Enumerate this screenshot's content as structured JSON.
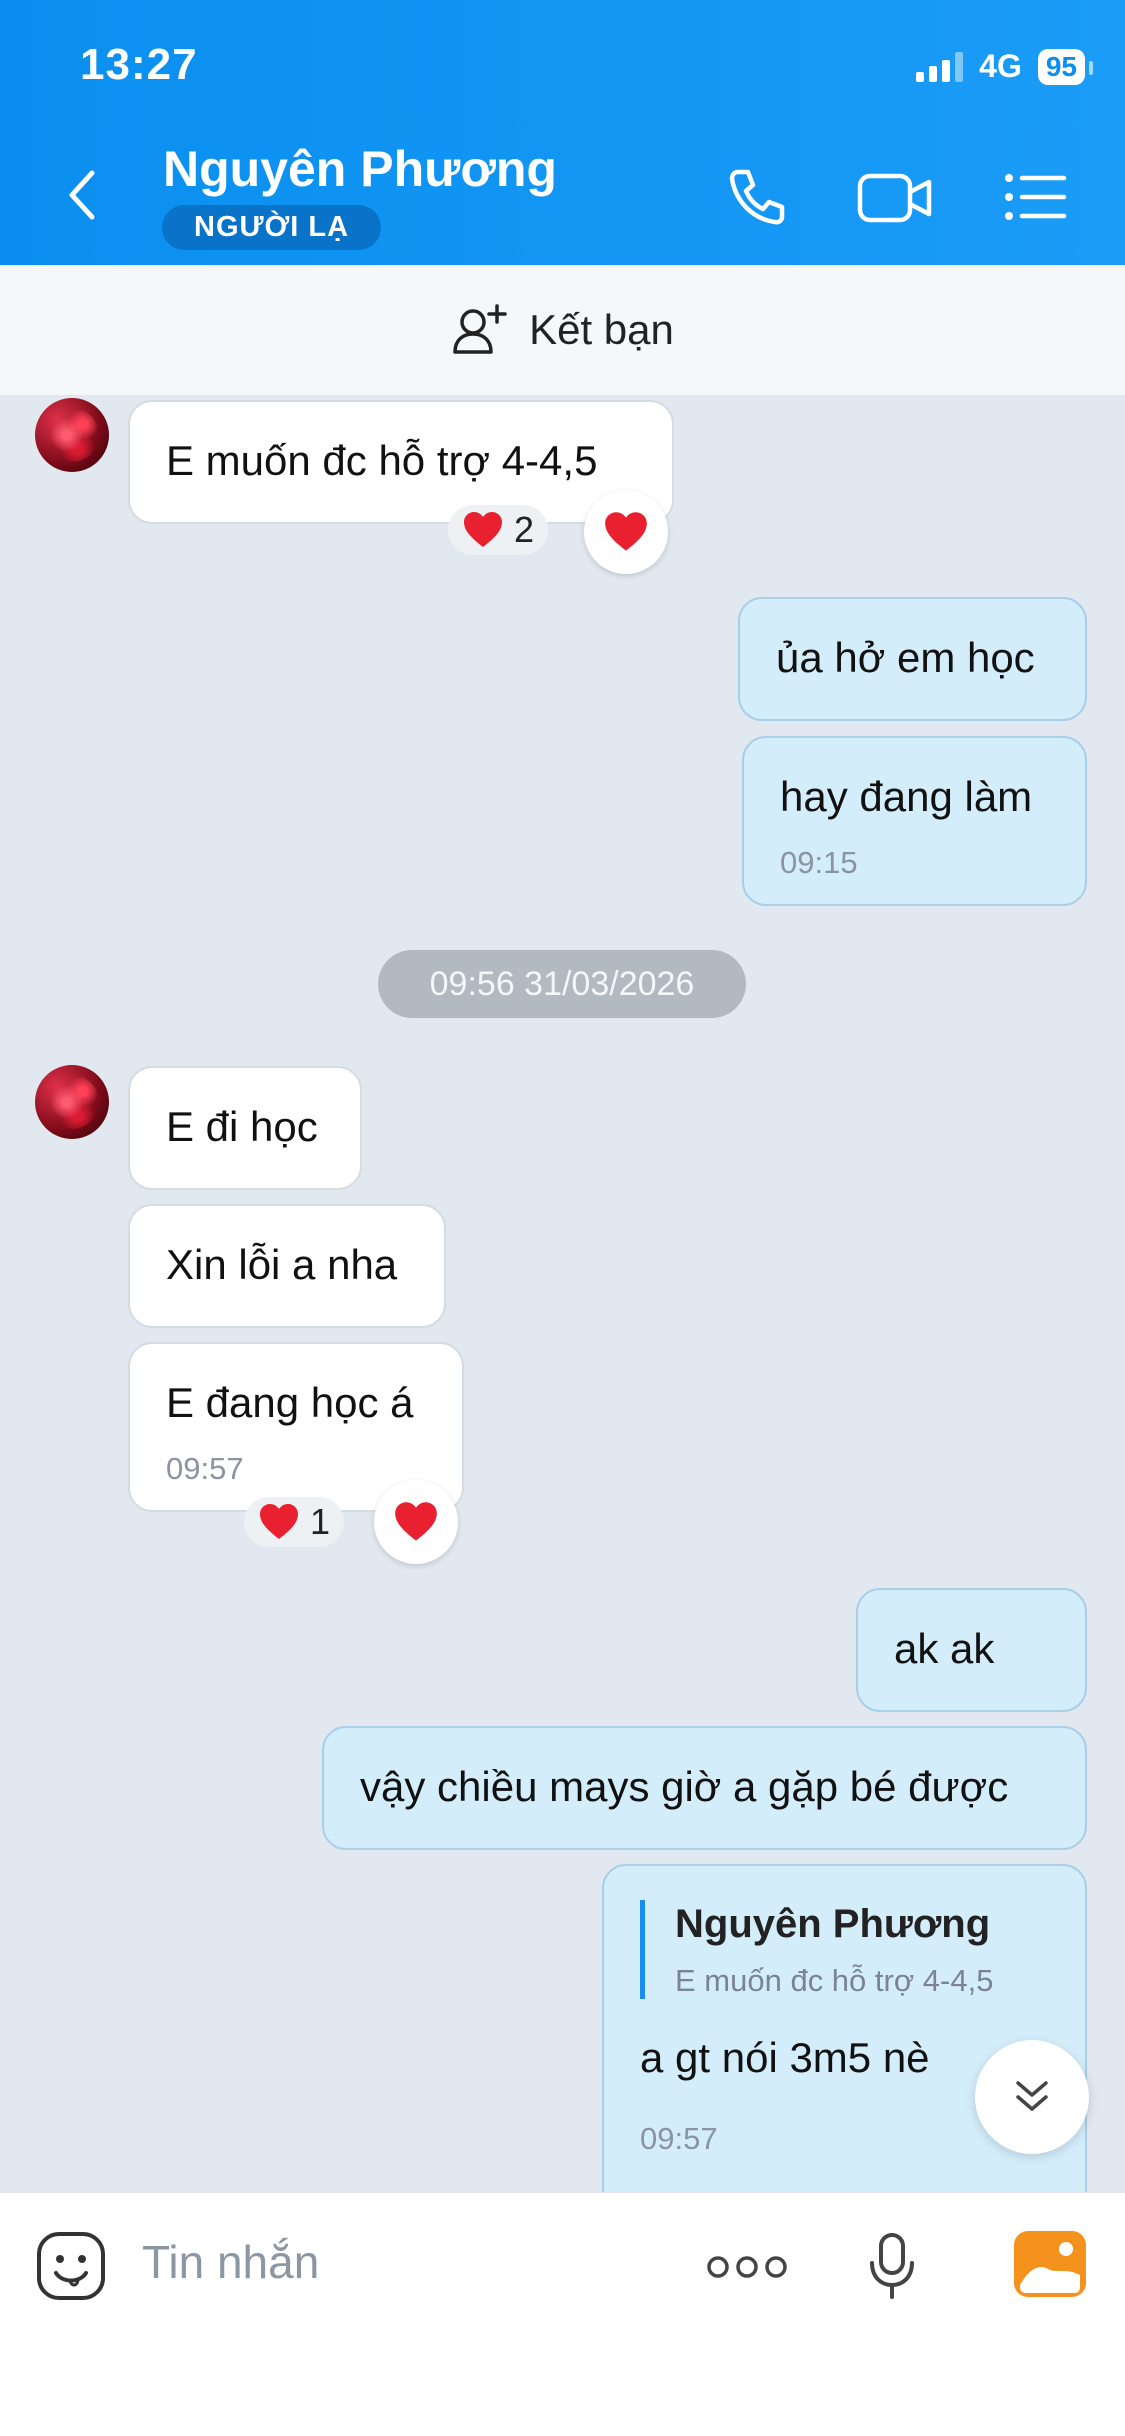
{
  "status_bar": {
    "time": "13:27",
    "network": "4G",
    "battery": "95"
  },
  "header": {
    "title": "Nguyên Phương",
    "badge": "NGƯỜI LẠ"
  },
  "add_friend": {
    "label": "Kết bạn"
  },
  "messages": [
    {
      "text": "E muốn đc hỗ trợ 4-4,5",
      "reaction_count": "2"
    },
    {
      "text": "ủa hở em học"
    },
    {
      "text": "hay đang làm",
      "time": "09:15"
    },
    {
      "date_separator": "09:56 31/03/2026"
    },
    {
      "text": "E đi học"
    },
    {
      "text": "Xin lỗi a nha"
    },
    {
      "text": "E đang học á",
      "time": "09:57",
      "reaction_count": "1"
    },
    {
      "text": "ak ak"
    },
    {
      "text": "vậy chiều mays giờ a gặp bé được"
    },
    {
      "quote_name": "Nguyên Phương",
      "quote_text": "E muốn đc hỗ trợ 4-4,5",
      "text": "a gt nói 3m5 nè",
      "time": "09:57"
    }
  ],
  "input": {
    "placeholder": "Tin nhắn"
  },
  "colors": {
    "header": "#0a8ff0",
    "outgoing_bubble": "#d4edfb",
    "incoming_bubble": "#ffffff",
    "background": "#e2e8f0"
  },
  "icons": [
    "back-arrow-icon",
    "phone-icon",
    "video-call-icon",
    "menu-list-icon",
    "add-friend-icon",
    "heart-icon",
    "chevron-double-down-icon",
    "sticker-icon",
    "more-icon",
    "microphone-icon",
    "image-icon"
  ]
}
